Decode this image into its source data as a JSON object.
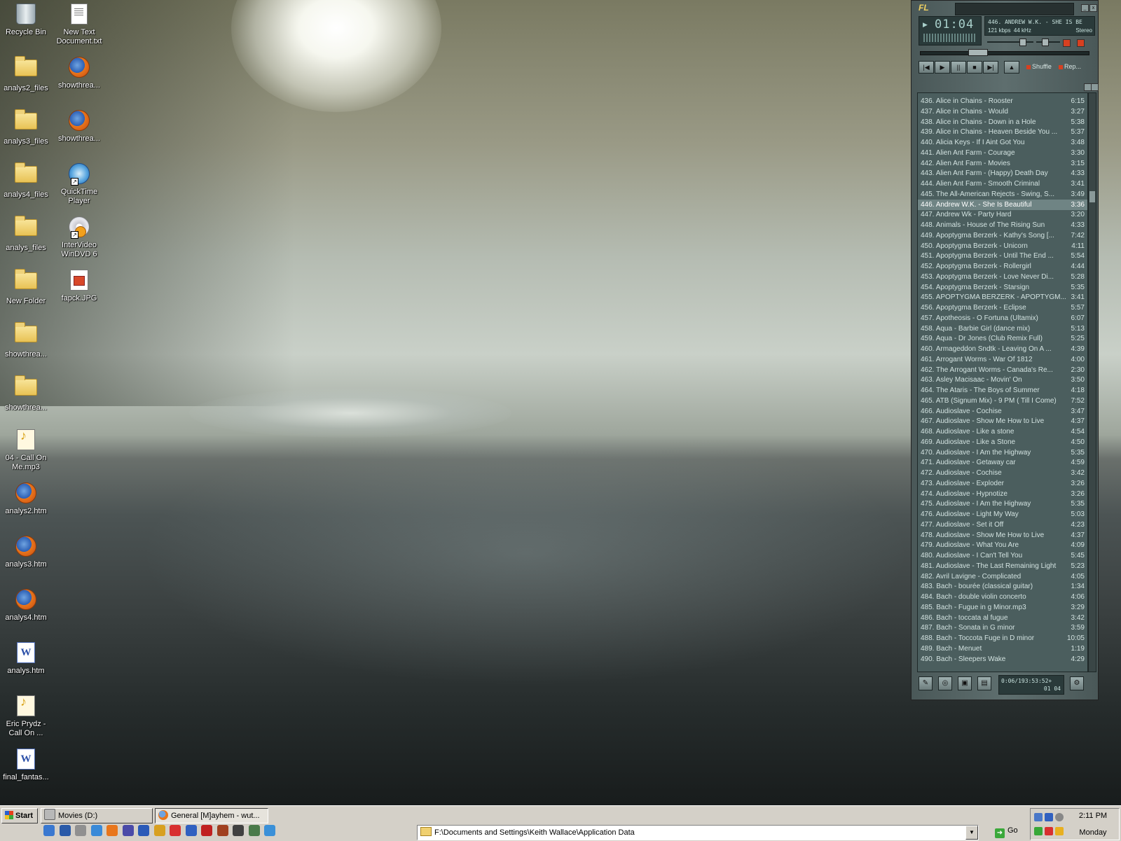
{
  "desktop_icons": [
    {
      "label": "Recycle Bin",
      "icon": "recycle-bin-icon"
    },
    {
      "label": "New Text Document.txt",
      "icon": "text-document-icon"
    },
    {
      "label": "analys2_files",
      "icon": "folder-icon"
    },
    {
      "label": "showthrea...",
      "icon": "firefox-html-icon"
    },
    {
      "label": "analys3_files",
      "icon": "folder-icon"
    },
    {
      "label": "showthrea...",
      "icon": "firefox-html-icon"
    },
    {
      "label": "analys4_files",
      "icon": "folder-icon"
    },
    {
      "label": "QuickTime Player",
      "icon": "quicktime-icon"
    },
    {
      "label": "analys_files",
      "icon": "folder-icon"
    },
    {
      "label": "InterVideo WinDVD 6",
      "icon": "windvd-icon"
    },
    {
      "label": "New Folder",
      "icon": "folder-icon"
    },
    {
      "label": "fapck.JPG",
      "icon": "jpg-image-icon"
    },
    {
      "label": "showthrea...",
      "icon": "folder-icon"
    },
    {
      "label": "showthrea...",
      "icon": "folder-icon"
    },
    {
      "label": "04 - Call On Me.mp3",
      "icon": "mp3-file-icon"
    },
    {
      "label": "analys2.htm",
      "icon": "firefox-html-icon"
    },
    {
      "label": "analys3.htm",
      "icon": "firefox-html-icon"
    },
    {
      "label": "analys4.htm",
      "icon": "firefox-html-icon"
    },
    {
      "label": "analys.htm",
      "icon": "word-document-icon"
    },
    {
      "label": "Eric Prydz - Call On ...",
      "icon": "mp3-file-icon"
    },
    {
      "label": "final_fantas...",
      "icon": "word-document-icon"
    }
  ],
  "player": {
    "logo": "FL",
    "time": "01:04",
    "now_playing": "446. ANDREW W.K. - SHE IS BE",
    "kbps": "121 kbps",
    "khz": "44 kHz",
    "stereo": "Stereo",
    "shuffle_label": "Shuffle",
    "repeat_label": "Rep...",
    "playlist_info_total": "0:06/193:53:52+",
    "playlist_info_time": "01 04",
    "playlist": [
      {
        "title": "436. Alice in Chains - Rooster",
        "duration": "6:15"
      },
      {
        "title": "437. Alice in Chains - Would",
        "duration": "3:27"
      },
      {
        "title": "438. Alice in Chains - Down in a Hole",
        "duration": "5:38"
      },
      {
        "title": "439. Alice in Chains - Heaven Beside You ...",
        "duration": "5:37"
      },
      {
        "title": "440. Alicia Keys - If I Aint Got You",
        "duration": "3:48"
      },
      {
        "title": "441. Alien Ant Farm - Courage",
        "duration": "3:30"
      },
      {
        "title": "442. Alien Ant Farm - Movies",
        "duration": "3:15"
      },
      {
        "title": "443. Alien Ant Farm - (Happy) Death Day",
        "duration": "4:33"
      },
      {
        "title": "444. Alien Ant Farm - Smooth Criminal",
        "duration": "3:41"
      },
      {
        "title": "445. The All-American Rejects - Swing, S...",
        "duration": "3:49"
      },
      {
        "title": "446. Andrew W.K. - She Is Beautiful",
        "duration": "3:36",
        "selected": true
      },
      {
        "title": "447. Andrew Wk - Party Hard",
        "duration": "3:20"
      },
      {
        "title": "448. Animals - House of The Rising Sun",
        "duration": "4:33"
      },
      {
        "title": "449. Apoptygma Berzerk - Kathy's Song [...",
        "duration": "7:42"
      },
      {
        "title": "450. Apoptygma Berzerk - Unicorn",
        "duration": "4:11"
      },
      {
        "title": "451. Apoptygma Berzerk - Until The End ...",
        "duration": "5:54"
      },
      {
        "title": "452. Apoptygma Berzerk - Rollergirl",
        "duration": "4:44"
      },
      {
        "title": "453. Apoptygma Berzerk - Love Never Di...",
        "duration": "5:28"
      },
      {
        "title": "454. Apoptygma Berzerk - Starsign",
        "duration": "5:35"
      },
      {
        "title": "455. APOPTYGMA BERZERK - APOPTYGM...",
        "duration": "3:41"
      },
      {
        "title": "456. Apoptygma Berzerk - Eclipse",
        "duration": "5:57"
      },
      {
        "title": "457. Apotheosis - O Fortuna (Ultamix)",
        "duration": "6:07"
      },
      {
        "title": "458. Aqua - Barbie Girl (dance mix)",
        "duration": "5:13"
      },
      {
        "title": "459. Aqua - Dr Jones (Club Remix Full)",
        "duration": "5:25"
      },
      {
        "title": "460. Armageddon Sndtk - Leaving On A ...",
        "duration": "4:39"
      },
      {
        "title": "461. Arrogant Worms - War Of 1812",
        "duration": "4:00"
      },
      {
        "title": "462. The Arrogant Worms - Canada's Re...",
        "duration": "2:30"
      },
      {
        "title": "463. Asley Macisaac - Movin' On",
        "duration": "3:50"
      },
      {
        "title": "464. The Ataris - The Boys of Summer",
        "duration": "4:18"
      },
      {
        "title": "465. ATB (Signum Mix) - 9 PM ( Till I Come)",
        "duration": "7:52"
      },
      {
        "title": "466. Audioslave - Cochise",
        "duration": "3:47"
      },
      {
        "title": "467. Audioslave - Show Me How to Live",
        "duration": "4:37"
      },
      {
        "title": "468. Audioslave - Like a stone",
        "duration": "4:54"
      },
      {
        "title": "469. Audioslave - Like a Stone",
        "duration": "4:50"
      },
      {
        "title": "470. Audioslave - I Am the Highway",
        "duration": "5:35"
      },
      {
        "title": "471. Audioslave - Getaway car",
        "duration": "4:59"
      },
      {
        "title": "472. Audioslave - Cochise",
        "duration": "3:42"
      },
      {
        "title": "473. Audioslave - Exploder",
        "duration": "3:26"
      },
      {
        "title": "474. Audioslave - Hypnotize",
        "duration": "3:26"
      },
      {
        "title": "475. Audioslave - I Am the Highway",
        "duration": "5:35"
      },
      {
        "title": "476. Audioslave - Light My Way",
        "duration": "5:03"
      },
      {
        "title": "477. Audioslave - Set it Off",
        "duration": "4:23"
      },
      {
        "title": "478. Audioslave - Show Me How to Live",
        "duration": "4:37"
      },
      {
        "title": "479. Audioslave - What You Are",
        "duration": "4:09"
      },
      {
        "title": "480. Audioslave - I Can't Tell You",
        "duration": "5:45"
      },
      {
        "title": "481. Audioslave - The Last Remaining Light",
        "duration": "5:23"
      },
      {
        "title": "482. Avril Lavigne - Complicated",
        "duration": "4:05"
      },
      {
        "title": "483. Bach - bourée (classical guitar)",
        "duration": "1:34"
      },
      {
        "title": "484. Bach - double violin concerto",
        "duration": "4:06"
      },
      {
        "title": "485. Bach - Fugue in g Minor.mp3",
        "duration": "3:29"
      },
      {
        "title": "486. Bach - toccata al fugue",
        "duration": "3:42"
      },
      {
        "title": "487. Bach - Sonata in G minor",
        "duration": "3:59"
      },
      {
        "title": "488. Bach - Toccota Fuge in D minor",
        "duration": "10:05"
      },
      {
        "title": "489. Bach - Menuet",
        "duration": "1:19"
      },
      {
        "title": "490. Bach - Sleepers Wake",
        "duration": "4:29"
      }
    ]
  },
  "taskbar": {
    "start_label": "Start",
    "tasks": [
      {
        "label": "Movies (D:)",
        "icon": "drive-icon"
      },
      {
        "label": "General [M]ayhem - wut...",
        "icon": "firefox-icon"
      }
    ],
    "address_value": "F:\\Documents and Settings\\Keith Wallace\\Application Data",
    "go_label": "Go",
    "clock": "2:11 PM",
    "day": "Monday"
  }
}
